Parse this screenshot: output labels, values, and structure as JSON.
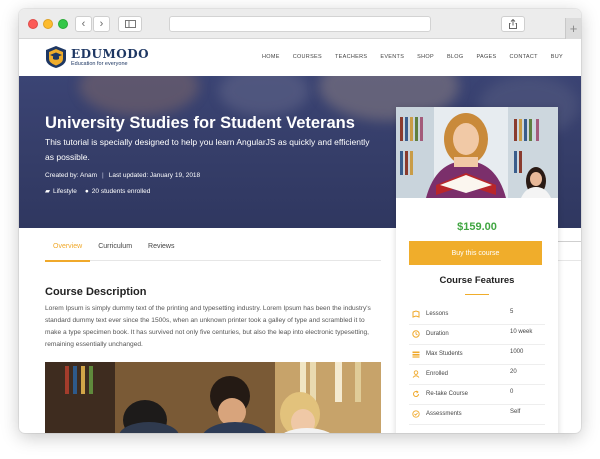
{
  "site": {
    "logo_name": "EDUMODO",
    "logo_tagline": "Education for everyone",
    "menu": [
      "HOME",
      "COURSES",
      "TEACHERS",
      "EVENTS",
      "SHOP",
      "BLOG",
      "PAGES",
      "CONTACT",
      "BUY"
    ]
  },
  "hero": {
    "title": "University Studies for Student Veterans",
    "subtitle": "This tutorial is specially designed to help you learn AngularJS as quickly and efficiently as possible.",
    "created_by": "Created by: Anam",
    "separator": "|",
    "last_updated": "Last updated: January 19, 2018",
    "category": "Lifestyle",
    "enrolled": "20 students enrolled"
  },
  "tabs": [
    "Overview",
    "Curriculum",
    "Reviews"
  ],
  "description": {
    "title": "Course Description",
    "body": "Lorem Ipsum is simply dummy text of the printing and typesetting industry. Lorem Ipsum has been the industry's standard dummy text ever since the 1500s, when an unknown printer took a galley of type and scrambled it to make a type specimen book. It has survived not only five centuries, but also the leap into electronic typesetting, remaining essentially unchanged."
  },
  "card": {
    "price": "$159.00",
    "buy_label": "Buy this course",
    "features_title": "Course Features",
    "features": [
      {
        "icon": "lessons-icon",
        "label": "Lessons",
        "value": "5"
      },
      {
        "icon": "clock-icon",
        "label": "Duration",
        "value": "10 week"
      },
      {
        "icon": "students-icon",
        "label": "Max Students",
        "value": "1000"
      },
      {
        "icon": "user-icon",
        "label": "Enrolled",
        "value": "20"
      },
      {
        "icon": "retake-icon",
        "label": "Re-take Course",
        "value": "0"
      },
      {
        "icon": "check-icon",
        "label": "Assessments",
        "value": "Self"
      }
    ]
  },
  "colors": {
    "accent": "#f0ad2b",
    "price": "#41a642",
    "hero": "#353d68",
    "brand": "#1e3763"
  }
}
